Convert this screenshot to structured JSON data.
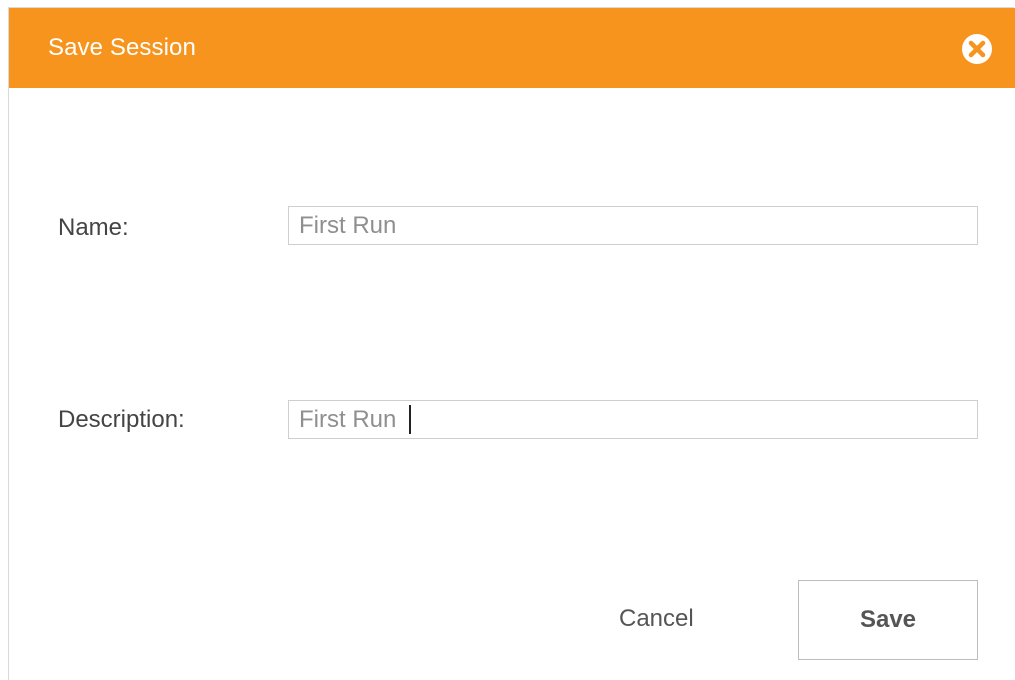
{
  "dialog": {
    "title": "Save Session",
    "close_icon": "close-circle-icon",
    "accent_color": "#f7941d"
  },
  "form": {
    "name_label": "Name:",
    "name_value": "First Run",
    "description_label": "Description:",
    "description_value": "First Run",
    "focused_field": "description"
  },
  "actions": {
    "cancel_label": "Cancel",
    "save_label": "Save"
  }
}
